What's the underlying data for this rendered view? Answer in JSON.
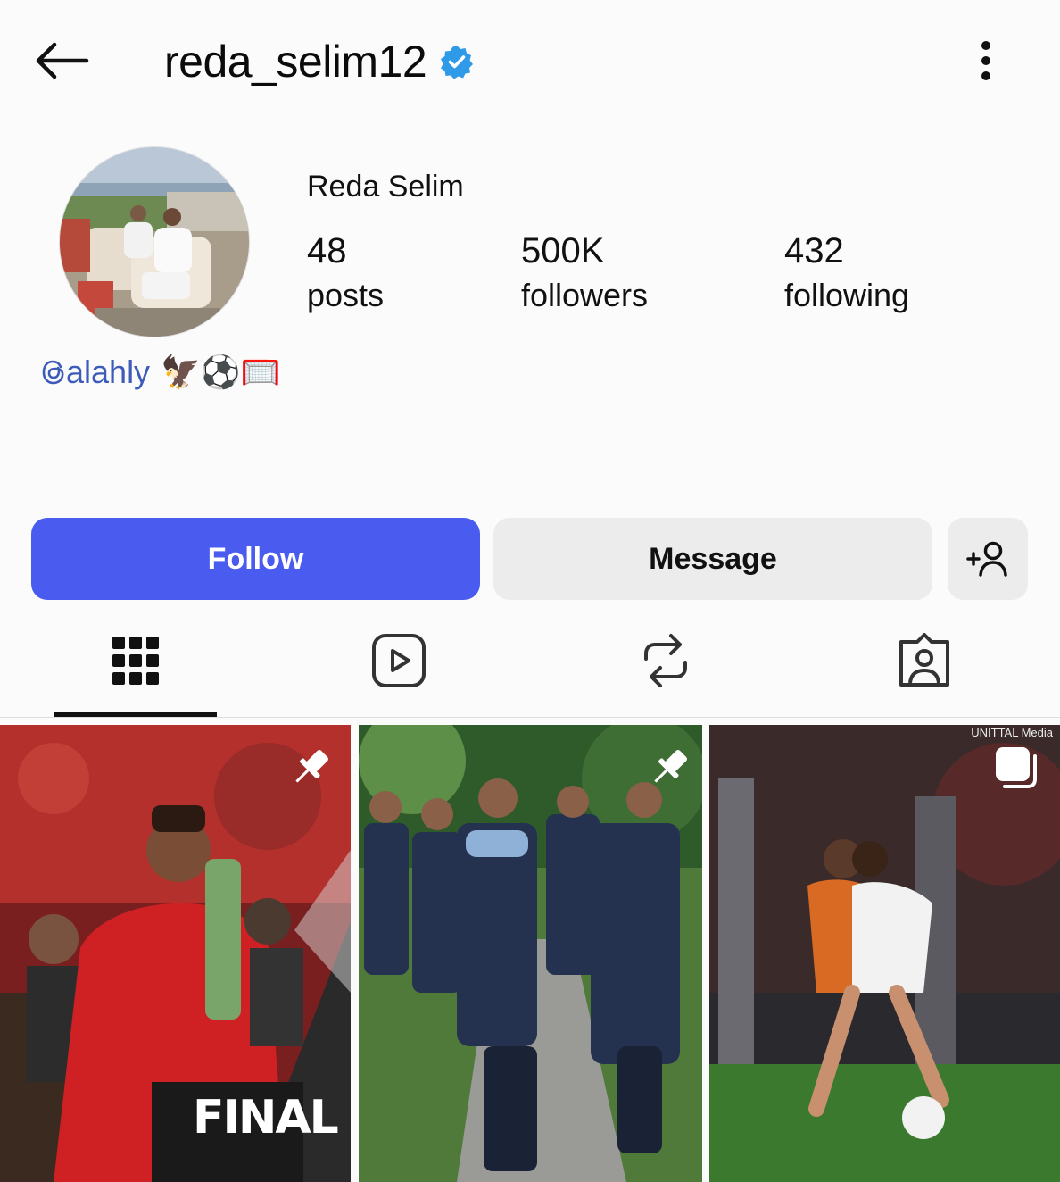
{
  "header": {
    "username": "reda_selim12",
    "verified_icon": "verified-badge-icon",
    "back_icon": "arrow-left-icon",
    "more_icon": "more-vertical-icon"
  },
  "profile": {
    "display_name": "Reda Selim",
    "stats": [
      {
        "value": "48",
        "label": "posts"
      },
      {
        "value": "500K",
        "label": "followers"
      },
      {
        "value": "432",
        "label": "following"
      }
    ],
    "bio_link": "alahly",
    "bio_emoji": "🦅⚽🥅"
  },
  "actions": {
    "follow_label": "Follow",
    "message_label": "Message",
    "add_person_icon": "add-person-icon"
  },
  "tabs": [
    {
      "name": "grid",
      "icon": "grid-icon",
      "selected": true
    },
    {
      "name": "reels",
      "icon": "reels-icon",
      "selected": false
    },
    {
      "name": "reposts",
      "icon": "repost-icon",
      "selected": false
    },
    {
      "name": "tagged",
      "icon": "tagged-icon",
      "selected": false
    }
  ],
  "posts": [
    {
      "pinned": true,
      "overlay_text": "FINAL"
    },
    {
      "pinned": true
    },
    {
      "pinned": false,
      "multi_item": true,
      "watermark": "UNITTAL Media"
    }
  ],
  "colors": {
    "follow_button": "#4a5cf0",
    "secondary_button": "#ececec",
    "verified_badge": "#2f9ae8",
    "bio_link": "#3d5bb8"
  }
}
